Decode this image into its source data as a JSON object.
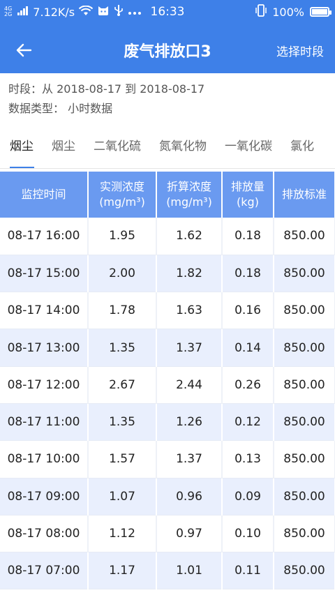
{
  "status": {
    "network": [
      "4G",
      "2G"
    ],
    "speed": "7.12K/s",
    "time": "16:33",
    "battery": "100%",
    "battery_level": 1.0
  },
  "header": {
    "title": "废气排放口3",
    "action": "选择时段"
  },
  "info": {
    "period": "时段：从 2018-08-17 到 2018-08-17",
    "data_type": "数据类型：  小时数据"
  },
  "tabs": [
    "烟尘",
    "烟尘",
    "二氧化硫",
    "氮氧化物",
    "一氧化碳",
    "氯化"
  ],
  "active_tab": 0,
  "table": {
    "headers": [
      [
        "监控时间",
        ""
      ],
      [
        "实测浓度",
        "(mg/m³)"
      ],
      [
        "折算浓度",
        "(mg/m³)"
      ],
      [
        "排放量",
        "(kg)"
      ],
      [
        "排放标准",
        ""
      ]
    ],
    "rows": [
      [
        "08-17 16:00",
        "1.95",
        "1.62",
        "0.18",
        "850.00"
      ],
      [
        "08-17 15:00",
        "2.00",
        "1.82",
        "0.18",
        "850.00"
      ],
      [
        "08-17 14:00",
        "1.78",
        "1.63",
        "0.16",
        "850.00"
      ],
      [
        "08-17 13:00",
        "1.35",
        "1.37",
        "0.14",
        "850.00"
      ],
      [
        "08-17 12:00",
        "2.67",
        "2.44",
        "0.26",
        "850.00"
      ],
      [
        "08-17 11:00",
        "1.35",
        "1.26",
        "0.12",
        "850.00"
      ],
      [
        "08-17 10:00",
        "1.57",
        "1.37",
        "0.13",
        "850.00"
      ],
      [
        "08-17 09:00",
        "1.07",
        "0.96",
        "0.09",
        "850.00"
      ],
      [
        "08-17 08:00",
        "1.12",
        "0.97",
        "0.10",
        "850.00"
      ],
      [
        "08-17 07:00",
        "1.17",
        "1.01",
        "0.11",
        "850.00"
      ]
    ]
  },
  "colors": {
    "primary": "#3e80e8",
    "table_header": "#6a9af0",
    "row_alt": "#e9effd"
  }
}
